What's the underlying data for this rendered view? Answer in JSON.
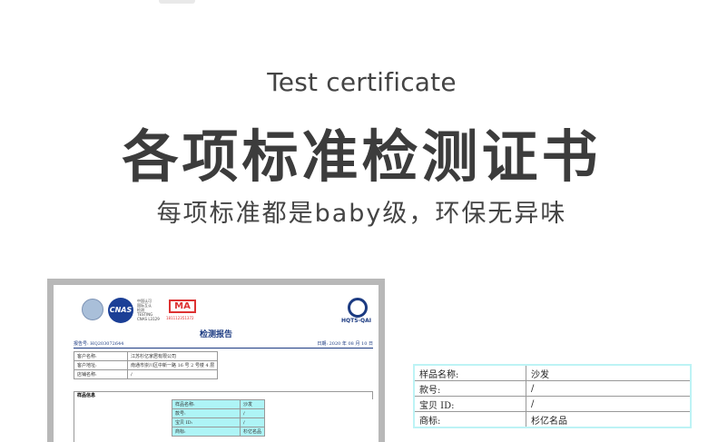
{
  "header": {
    "subtitle_en": "Test certificate",
    "title_cn": "各项标准检测证书",
    "tagline_cn": "每项标准都是baby级，环保无异味"
  },
  "certificate": {
    "logos": {
      "ilac": "ilac-MRA",
      "cnas": "CNAS",
      "cnas_lines": [
        "中国认可",
        "国际互认",
        "检测",
        "TESTING",
        "CNAS L3129"
      ],
      "ma": "MA",
      "ma_number": "181112351372",
      "hqts": "HQTS-QAI"
    },
    "title": "检测报告",
    "report_no": "报告号: HQ203072644",
    "date": "日期: 2020 年 08 月 10 日",
    "info": [
      {
        "k": "客户名称:",
        "v": "江苏杉亿家居有限公司"
      },
      {
        "k": "客户地址:",
        "v": "南通市崇川区中新一路 16 号 2 号楼 4 层"
      },
      {
        "k": "店铺名称:",
        "v": "/"
      }
    ],
    "sample_header": "样品信息",
    "sample": [
      {
        "k": "样品名称:",
        "v": "沙发"
      },
      {
        "k": "款号:",
        "v": "/"
      },
      {
        "k": "宝贝 ID:",
        "v": "/"
      },
      {
        "k": "商标:",
        "v": "杉亿名品"
      }
    ]
  },
  "zoom": [
    {
      "k": "样品名称:",
      "v": "沙发"
    },
    {
      "k": "款号:",
      "v": "/"
    },
    {
      "k": "宝贝 ID:",
      "v": "/"
    },
    {
      "k": "商标:",
      "v": "杉亿名品"
    }
  ],
  "colors": {
    "title": "#3c3c3c",
    "highlight": "#aef4f6",
    "report_blue": "#1c3b82",
    "ma_red": "#dd3333"
  }
}
